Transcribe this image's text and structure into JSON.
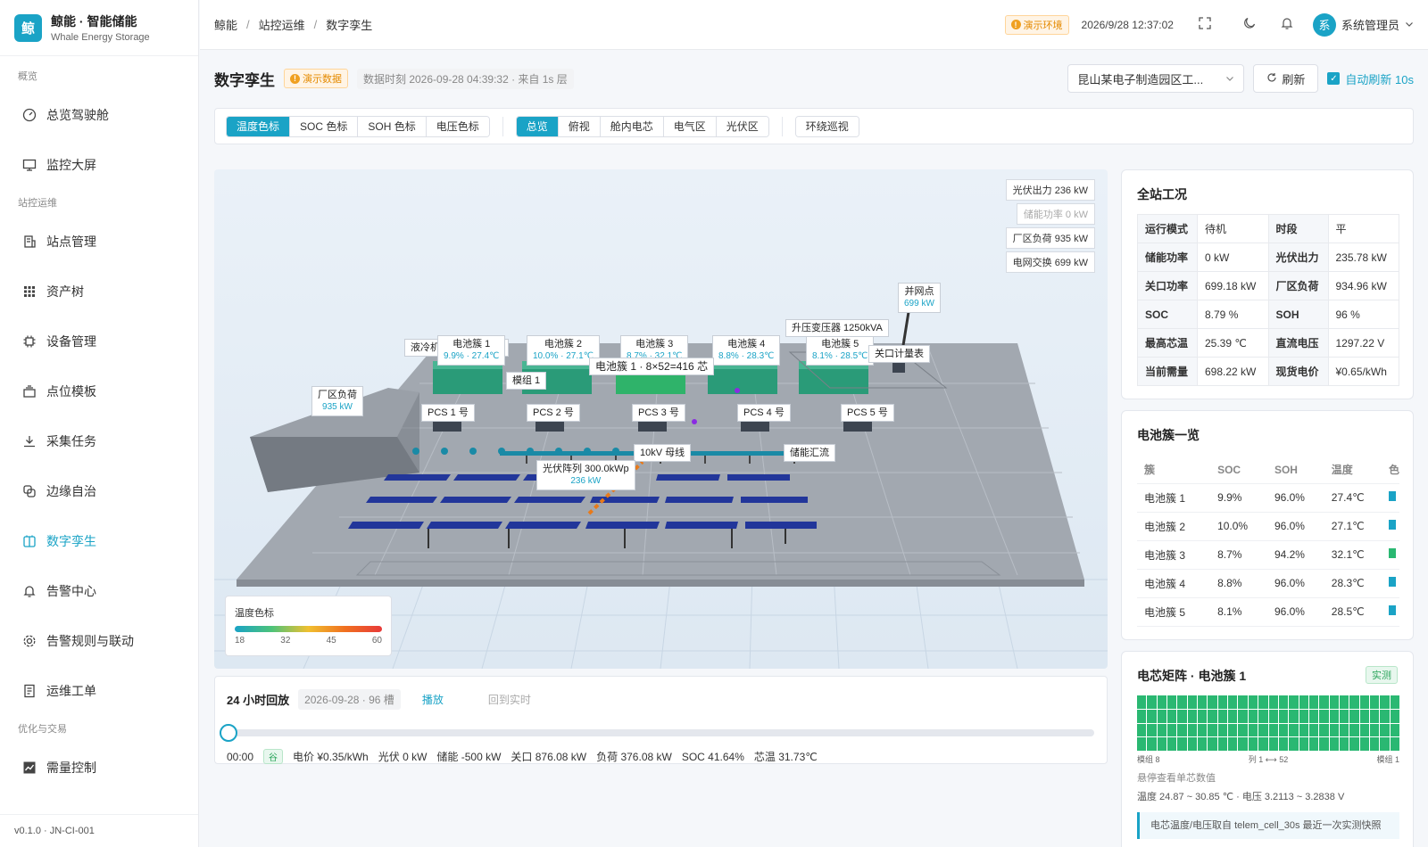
{
  "app": {
    "logo_char": "鲸",
    "title": "鲸能 · 智能储能",
    "subtitle": "Whale Energy Storage",
    "version": "v0.1.0 · JN-CI-001"
  },
  "nav": {
    "groups": [
      {
        "label": "概览"
      },
      {
        "label": "站控运维"
      },
      {
        "label": "优化与交易"
      }
    ],
    "items": [
      {
        "label": "总览驾驶舱"
      },
      {
        "label": "监控大屏"
      },
      {
        "label": "站点管理"
      },
      {
        "label": "资产树"
      },
      {
        "label": "设备管理"
      },
      {
        "label": "点位模板"
      },
      {
        "label": "采集任务"
      },
      {
        "label": "边缘自治"
      },
      {
        "label": "数字孪生"
      },
      {
        "label": "告警中心"
      },
      {
        "label": "告警规则与联动"
      },
      {
        "label": "运维工单"
      },
      {
        "label": "需量控制"
      }
    ]
  },
  "topbar": {
    "breadcrumb": [
      "鲸能",
      "站控运维",
      "数字孪生"
    ],
    "env_tag": "演示环境",
    "datetime": "2026/9/28 12:37:02",
    "avatar_char": "系",
    "user": "系统管理员"
  },
  "page": {
    "title": "数字孪生",
    "demo_tag": "演示数据",
    "data_time": "数据时刻 2026-09-28 04:39:32 · 来自 1s 层",
    "site_select": "昆山某电子制造园区工...",
    "refresh": "刷新",
    "auto_refresh": "自动刷新 10s"
  },
  "toolbar": {
    "color_modes": [
      "温度色标",
      "SOC 色标",
      "SOH 色标",
      "电压色标"
    ],
    "views": [
      "总览",
      "俯视",
      "舱内电芯",
      "电气区",
      "光伏区"
    ],
    "patrol": "环绕巡视"
  },
  "scene": {
    "summary": [
      "光伏出力 236 kW",
      "储能功率 0 kW",
      "厂区负荷 935 kW",
      "电网交换 699 kW"
    ],
    "clusters": [
      {
        "name": "电池簇 1",
        "val": "9.9% · 27.4℃"
      },
      {
        "name": "电池簇 2",
        "val": "10.0% · 27.1℃"
      },
      {
        "name": "电池簇 3",
        "val": "8.7% · 32.1℃"
      },
      {
        "name": "电池簇 4",
        "val": "8.8% · 28.3℃"
      },
      {
        "name": "电池簇 5",
        "val": "8.1% · 28.5℃"
      }
    ],
    "pcs": [
      "PCS 1 号",
      "PCS 2 号",
      "PCS 3 号",
      "PCS 4 号",
      "PCS 5 号"
    ],
    "labels": {
      "chiller": "液冷机",
      "chiller2": "机",
      "module": "模组 1",
      "cells": "电池簇 1 · 8×52=416 芯",
      "transformer": "升压变压器 1250kVA",
      "meter": "关口计量表",
      "grid_point": "并网点",
      "grid_val": "699 kW",
      "load": "厂区负荷",
      "load_val": "935 kW",
      "bus": "10kV 母线",
      "combiner": "储能汇流",
      "pv": "光伏阵列 300.0kWp",
      "pv_val": "236 kW"
    },
    "legend": {
      "title": "温度色标",
      "ticks": [
        "18",
        "32",
        "45",
        "60"
      ]
    }
  },
  "replay": {
    "title": "24 小时回放",
    "date_tag": "2026-09-28 · 96 槽",
    "play": "播放",
    "back": "回到实时",
    "time": "00:00",
    "period": "谷",
    "price": "电价 ¥0.35/kWh",
    "pv": "光伏 0 kW",
    "ess": "储能 -500 kW",
    "gate": "关口 876.08 kW",
    "load": "负荷 376.08 kW",
    "soc": "SOC 41.64%",
    "temp": "芯温 31.73℃",
    "progress": 0
  },
  "status_card": {
    "title": "全站工况",
    "rows": [
      [
        "运行模式",
        "待机",
        "时段",
        "平"
      ],
      [
        "储能功率",
        "0 kW",
        "光伏出力",
        "235.78 kW"
      ],
      [
        "关口功率",
        "699.18 kW",
        "厂区负荷",
        "934.96 kW"
      ],
      [
        "SOC",
        "8.79 %",
        "SOH",
        "96 %"
      ],
      [
        "最高芯温",
        "25.39 ℃",
        "直流电压",
        "1297.22 V"
      ],
      [
        "当前需量",
        "698.22 kW",
        "现货电价",
        "¥0.65/kWh"
      ]
    ]
  },
  "cluster_card": {
    "title": "电池簇一览",
    "headers": [
      "簇",
      "SOC",
      "SOH",
      "温度",
      "色"
    ],
    "rows": [
      [
        "电池簇 1",
        "9.9%",
        "96.0%",
        "27.4℃"
      ],
      [
        "电池簇 2",
        "10.0%",
        "96.0%",
        "27.1℃"
      ],
      [
        "电池簇 3",
        "8.7%",
        "94.2%",
        "32.1℃"
      ],
      [
        "电池簇 4",
        "8.8%",
        "96.0%",
        "28.3℃"
      ],
      [
        "电池簇 5",
        "8.1%",
        "96.0%",
        "28.5℃"
      ]
    ],
    "swatches": [
      "#1aa3c6",
      "#1aa3c6",
      "#2ab872",
      "#1aa3c6",
      "#1aa3c6"
    ]
  },
  "matrix_card": {
    "title": "电芯矩阵 · 电池簇 1",
    "live": "实测",
    "axis": [
      "模组 8",
      "列 1 ⟷ 52",
      "模组 1"
    ],
    "hover": "悬停查看单芯数值",
    "range": "温度 24.87 ~ 30.85 ℃ · 电压 3.2113 ~ 3.2838 V",
    "note": "电芯温度/电压取自 telem_cell_30s 最近一次实测快照",
    "color": "#2ab872"
  },
  "colors": {
    "accent": "#1aa3c6",
    "ok": "#2ab872",
    "warn": "#f0a020",
    "panel": "#22369a",
    "container": "#2a9b78"
  }
}
